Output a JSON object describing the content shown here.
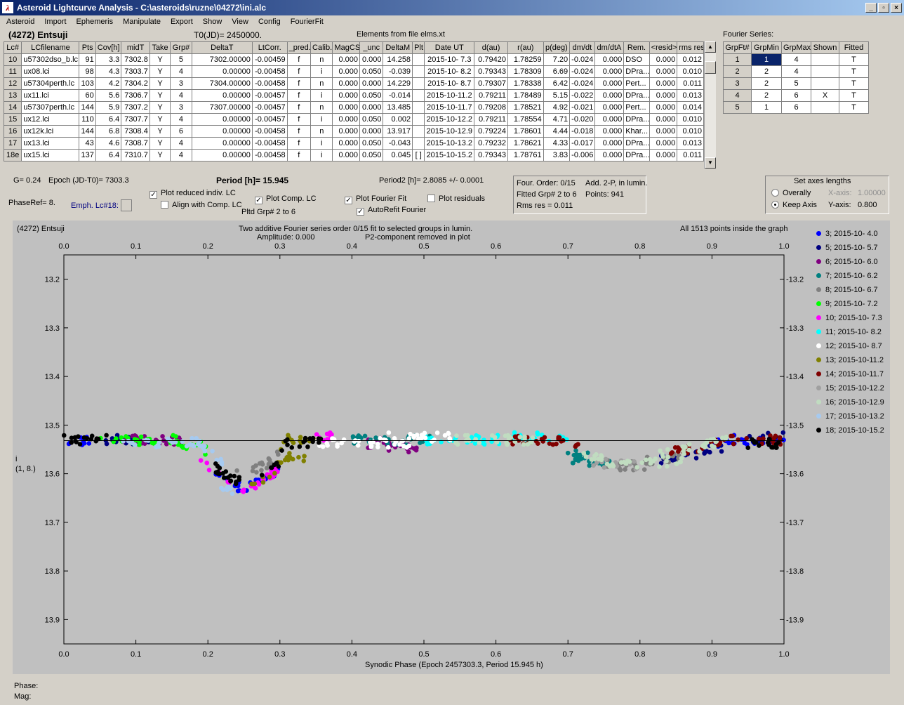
{
  "window": {
    "title": "Asteroid Lightcurve Analysis - C:\\asteroids\\ruzne\\04272\\ini.alc",
    "minimize": "_",
    "restore": "▫",
    "close": "×"
  },
  "menu": [
    "Asteroid",
    "Import",
    "Ephemeris",
    "Manipulate",
    "Export",
    "Show",
    "View",
    "Config",
    "FourierFit"
  ],
  "header": {
    "asteroid": "(4272) Entsuji",
    "t0": "T0(JD)= 2450000.",
    "elements": "Elements from file elms.xt"
  },
  "lc_table": {
    "columns": [
      "Lc#",
      "LCfilename",
      "Pts",
      "Cov[h]",
      "midT",
      "Take",
      "Grp#",
      "DeltaT",
      "LtCorr.",
      "_pred.",
      "Calib.",
      "MagCS",
      "_unc",
      "DeltaM",
      "Plt",
      "Date UT",
      "d(au)",
      "r(au)",
      "p(deg)",
      "dm/dt",
      "dm/dtA",
      "Rem.",
      "<resid>",
      "rms res"
    ],
    "rows": [
      [
        "10",
        "u57302dso_b.lc",
        "91",
        "3.3",
        "7302.8",
        "Y",
        "5",
        "7302.00000",
        "-0.00459",
        "f",
        "n",
        "0.000",
        "0.000",
        "14.258",
        "",
        "2015-10- 7.3",
        "0.79420",
        "1.78259",
        "7.20",
        "-0.024",
        "0.000",
        "DSO",
        "0.000",
        "0.012"
      ],
      [
        "11",
        "ux08.lci",
        "98",
        "4.3",
        "7303.7",
        "Y",
        "4",
        "0.00000",
        "-0.00458",
        "f",
        "i",
        "0.000",
        "0.050",
        "-0.039",
        "",
        "2015-10- 8.2",
        "0.79343",
        "1.78309",
        "6.69",
        "-0.024",
        "0.000",
        "DPra...",
        "0.000",
        "0.010"
      ],
      [
        "12",
        "u57304perth.lc",
        "103",
        "4.2",
        "7304.2",
        "Y",
        "3",
        "7304.00000",
        "-0.00458",
        "f",
        "n",
        "0.000",
        "0.000",
        "14.229",
        "",
        "2015-10- 8.7",
        "0.79307",
        "1.78338",
        "6.42",
        "-0.024",
        "0.000",
        "Pert...",
        "0.000",
        "0.011"
      ],
      [
        "13",
        "ux11.lci",
        "60",
        "5.6",
        "7306.7",
        "Y",
        "4",
        "0.00000",
        "-0.00457",
        "f",
        "i",
        "0.000",
        "0.050",
        "-0.014",
        "",
        "2015-10-11.2",
        "0.79211",
        "1.78489",
        "5.15",
        "-0.022",
        "0.000",
        "DPra...",
        "0.000",
        "0.013"
      ],
      [
        "14",
        "u57307perth.lc",
        "144",
        "5.9",
        "7307.2",
        "Y",
        "3",
        "7307.00000",
        "-0.00457",
        "f",
        "n",
        "0.000",
        "0.000",
        "13.485",
        "",
        "2015-10-11.7",
        "0.79208",
        "1.78521",
        "4.92",
        "-0.021",
        "0.000",
        "Pert...",
        "0.000",
        "0.014"
      ],
      [
        "15",
        "ux12.lci",
        "110",
        "6.4",
        "7307.7",
        "Y",
        "4",
        "0.00000",
        "-0.00457",
        "f",
        "i",
        "0.000",
        "0.050",
        "0.002",
        "",
        "2015-10-12.2",
        "0.79211",
        "1.78554",
        "4.71",
        "-0.020",
        "0.000",
        "DPra...",
        "0.000",
        "0.010"
      ],
      [
        "16",
        "ux12k.lci",
        "144",
        "6.8",
        "7308.4",
        "Y",
        "6",
        "0.00000",
        "-0.00458",
        "f",
        "n",
        "0.000",
        "0.000",
        "13.917",
        "",
        "2015-10-12.9",
        "0.79224",
        "1.78601",
        "4.44",
        "-0.018",
        "0.000",
        "Khar...",
        "0.000",
        "0.010"
      ],
      [
        "17",
        "ux13.lci",
        "43",
        "4.6",
        "7308.7",
        "Y",
        "4",
        "0.00000",
        "-0.00458",
        "f",
        "i",
        "0.000",
        "0.050",
        "-0.043",
        "",
        "2015-10-13.2",
        "0.79232",
        "1.78621",
        "4.33",
        "-0.017",
        "0.000",
        "DPra...",
        "0.000",
        "0.013"
      ],
      [
        "18e",
        "ux15.lci",
        "137",
        "6.4",
        "7310.7",
        "Y",
        "4",
        "0.00000",
        "-0.00458",
        "f",
        "i",
        "0.000",
        "0.050",
        "0.045",
        "[ ]",
        "2015-10-15.2",
        "0.79343",
        "1.78761",
        "3.83",
        "-0.006",
        "0.000",
        "DPra...",
        "0.000",
        "0.011"
      ]
    ]
  },
  "fourier": {
    "title": "Fourier Series:",
    "columns": [
      "GrpFt#",
      "GrpMin",
      "GrpMax",
      "Shown",
      "Fitted"
    ],
    "rows": [
      [
        "1",
        "1",
        "4",
        "",
        "T"
      ],
      [
        "2",
        "2",
        "4",
        "",
        "T"
      ],
      [
        "3",
        "2",
        "5",
        "",
        "T"
      ],
      [
        "4",
        "2",
        "6",
        "X",
        "T"
      ],
      [
        "5",
        "1",
        "6",
        "",
        "T"
      ]
    ]
  },
  "info": {
    "g": "G= 0.24",
    "epoch": "Epoch (JD-T0)= 7303.3",
    "period": "Period [h]= 15.945",
    "period2": "Period2 [h]= 2.8085 +/- 0.0001",
    "phase_ref": "PhaseRef= 8.",
    "emph": "Emph. Lc#18:",
    "plot_reduced": "Plot reduced indiv. LC",
    "align": "Align with Comp. LC",
    "plot_comp": "Plot Comp. LC",
    "pltd_grp": "Pltd Grp#  2  to  6",
    "plot_fourier": "Plot Fourier Fit",
    "autorefit": "AutoRefit Fourier",
    "plot_residuals": "Plot residuals",
    "check": "✓"
  },
  "fit_box": {
    "order": "Four. Order:  0/15",
    "add": "Add. 2-P, in lumin.",
    "fitted": "Fitted Grp# 2 to 6",
    "points": "Points: 941",
    "rms": "Rms res     = 0.011"
  },
  "axes_box": {
    "title": "Set axes lengths",
    "overally": "Overally",
    "keep": "Keep Axis",
    "xaxis_label": "X-axis:",
    "xaxis_val": "1.00000",
    "yaxis_label": "Y-axis:",
    "yaxis_val": "0.800"
  },
  "plot": {
    "asteroid": "(4272) Entsuji",
    "subtitle1": "Two additive Fourier series order 0/15 fit to selected groups in lumin.",
    "subtitle2": "Amplitude: 0.000",
    "subtitle3": "P2-component removed in plot",
    "points_note": "All 1513 points inside the graph",
    "ylabel": "i",
    "ylabel2": "(1, 8.)",
    "xlabel": "Synodic Phase (Epoch 2457303.3, Period 15.945 h)"
  },
  "chart_data": {
    "type": "scatter",
    "title": "Two additive Fourier series order 0/15 fit to selected groups in lumin.",
    "xlabel": "Synodic Phase (Epoch 2457303.3, Period 15.945 h)",
    "ylabel": "i",
    "xlim": [
      0.0,
      1.0
    ],
    "ylim": [
      13.95,
      13.15
    ],
    "xticks": [
      "0.0",
      "0.1",
      "0.2",
      "0.3",
      "0.4",
      "0.5",
      "0.6",
      "0.7",
      "0.8",
      "0.9",
      "1.0"
    ],
    "yticks": [
      "13.2",
      "13.3",
      "13.4",
      "13.5",
      "13.6",
      "13.7",
      "13.8",
      "13.9"
    ],
    "reference_mag": 13.532,
    "legend_placement": "right",
    "series": [
      {
        "name": "3; 2015-10- 4.0",
        "color": "#0000ff",
        "segments": [
          [
            0.0,
            0.04,
            13.53
          ],
          [
            0.2,
            0.3,
            13.6
          ],
          [
            0.9,
            1.0,
            13.53
          ]
        ]
      },
      {
        "name": "5; 2015-10- 5.7",
        "color": "#000080",
        "segments": [
          [
            0.05,
            0.12,
            13.53
          ],
          [
            0.82,
            0.92,
            13.55
          ],
          [
            0.95,
            1.0,
            13.52
          ]
        ]
      },
      {
        "name": "6; 2015-10- 6.0",
        "color": "#800080",
        "segments": [
          [
            0.08,
            0.18,
            13.53
          ],
          [
            0.42,
            0.48,
            13.54
          ],
          [
            0.45,
            0.49,
            13.56
          ]
        ]
      },
      {
        "name": "7; 2015-10- 6.2",
        "color": "#008080",
        "segments": [
          [
            0.4,
            0.52,
            13.53
          ],
          [
            0.69,
            0.76,
            13.56
          ],
          [
            0.7,
            0.75,
            13.58
          ]
        ]
      },
      {
        "name": "8; 2015-10- 6.7",
        "color": "#808080",
        "segments": [
          [
            0.24,
            0.3,
            13.55
          ],
          [
            0.75,
            0.82,
            13.57
          ],
          [
            0.8,
            0.86,
            13.55
          ]
        ]
      },
      {
        "name": "9; 2015-10- 7.2",
        "color": "#00ff00",
        "segments": [
          [
            0.05,
            0.16,
            13.53
          ],
          [
            0.16,
            0.2,
            13.55
          ]
        ]
      },
      {
        "name": "10; 2015-10- 7.3",
        "color": "#ff00ff",
        "segments": [
          [
            0.19,
            0.3,
            13.6
          ],
          [
            0.35,
            0.39,
            13.52
          ]
        ]
      },
      {
        "name": "11; 2015-10- 8.2",
        "color": "#00ffff",
        "segments": [
          [
            0.5,
            0.64,
            13.53
          ],
          [
            0.62,
            0.7,
            13.52
          ]
        ]
      },
      {
        "name": "12; 2015-10- 8.7",
        "color": "#ffffff",
        "segments": [
          [
            0.35,
            0.48,
            13.54
          ],
          [
            0.44,
            0.54,
            13.52
          ]
        ]
      },
      {
        "name": "13; 2015-10-11.2",
        "color": "#808000",
        "segments": [
          [
            0.26,
            0.34,
            13.59
          ],
          [
            0.3,
            0.35,
            13.53
          ]
        ]
      },
      {
        "name": "14; 2015-10-11.7",
        "color": "#800000",
        "segments": [
          [
            0.62,
            0.72,
            13.53
          ],
          [
            0.84,
            1.0,
            13.53
          ]
        ]
      },
      {
        "name": "15; 2015-10-12.2",
        "color": "#a0a0a0",
        "segments": [
          [
            0.73,
            0.8,
            13.57
          ]
        ]
      },
      {
        "name": "16; 2015-10-12.9",
        "color": "#c0dcc0",
        "segments": [
          [
            0.54,
            0.66,
            13.53
          ],
          [
            0.72,
            0.86,
            13.56
          ],
          [
            0.82,
            0.92,
            13.53
          ]
        ]
      },
      {
        "name": "17; 2015-10-13.2",
        "color": "#a6caf0",
        "segments": [
          [
            0.08,
            0.22,
            13.54
          ],
          [
            0.21,
            0.24,
            13.62
          ]
        ]
      },
      {
        "name": "18; 2015-10-15.2",
        "color": "#000000",
        "segments": [
          [
            0.0,
            0.06,
            13.53
          ],
          [
            0.2,
            0.3,
            13.58
          ],
          [
            0.3,
            0.36,
            13.54
          ],
          [
            0.94,
            1.0,
            13.54
          ]
        ]
      }
    ]
  },
  "status": {
    "phase": "Phase:",
    "mag": "Mag:"
  }
}
